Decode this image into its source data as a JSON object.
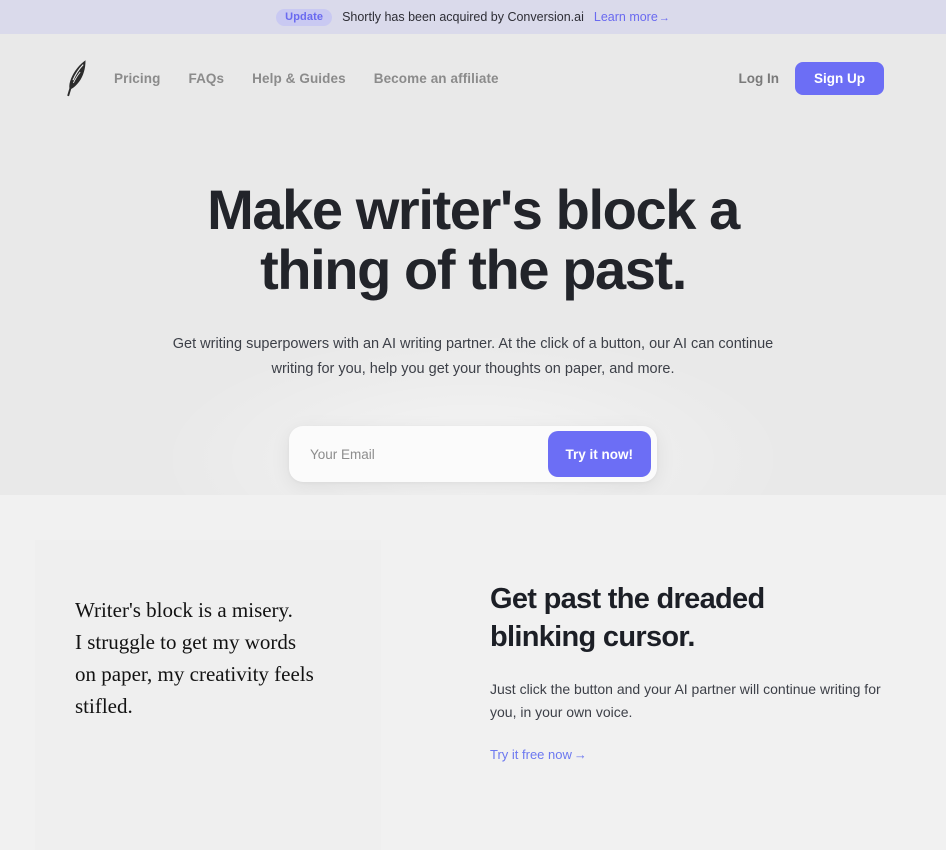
{
  "announcement": {
    "badge": "Update",
    "text": "Shortly has been acquired by Conversion.ai",
    "link": "Learn more",
    "arrow": "→",
    "bg_color": "#dadaeb",
    "badge_bg": "#c9c9f2",
    "accent": "#6a6af0"
  },
  "nav": {
    "logo_icon": "feather-quill-icon",
    "links": [
      {
        "label": "Pricing"
      },
      {
        "label": "FAQs"
      },
      {
        "label": "Help & Guides"
      },
      {
        "label": "Become an affiliate"
      }
    ],
    "login_label": "Log In",
    "signup_label": "Sign Up",
    "signup_color": "#6c6ef5"
  },
  "hero": {
    "title_line1": "Make writer's block a",
    "title_line2": "thing of the past.",
    "subtitle": "Get writing superpowers with an AI writing partner. At the click of a button, our AI can continue writing for you, help you get your thoughts on paper, and more.",
    "bg_color": "#e9e9e9",
    "form": {
      "email_placeholder": "Your Email",
      "email_value": "",
      "submit_label": "Try it now!",
      "submit_color": "#6c6ef5"
    }
  },
  "feature": {
    "bg_color": "#f1f1f1",
    "quote_line1": "Writer's block is a misery.",
    "quote_line2": "I struggle to get my words",
    "quote_line3": "on paper, my creativity feels",
    "quote_line4": "stifled.",
    "title_line1": "Get past the dreaded",
    "title_line2": "blinking cursor.",
    "body": "Just click the button and your AI partner will continue writing for you, in your own voice.",
    "link": "Try it free now",
    "link_arrow": "→",
    "link_color": "#6c78f0"
  }
}
